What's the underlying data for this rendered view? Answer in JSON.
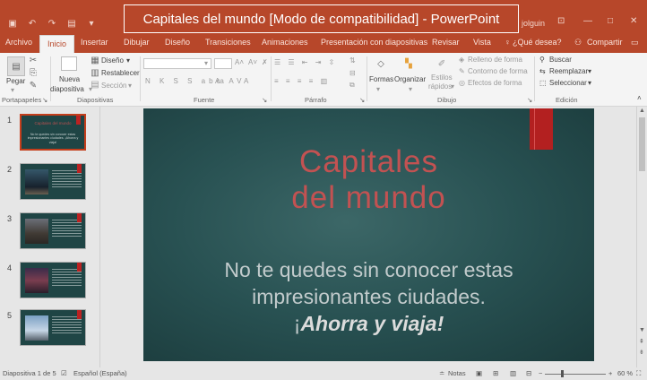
{
  "title_bar": {
    "window_title": "Capitales del mundo [Modo de compatibilidad]  -  PowerPoint",
    "user": "jolguin",
    "qat_icons": [
      "save-icon",
      "undo-icon",
      "redo-icon",
      "present-icon",
      "customize-icon"
    ]
  },
  "tabs": [
    "Archivo",
    "Inicio",
    "Insertar",
    "Dibujar",
    "Diseño",
    "Transiciones",
    "Animaciones",
    "Presentación con diapositivas",
    "Revisar",
    "Vista"
  ],
  "tell_me": "¿Qué desea?",
  "share": "Compartir",
  "ribbon": {
    "paste": "Pegar",
    "new_slide_1": "Nueva",
    "new_slide_2": "diapositiva",
    "layout": "Diseño",
    "reset": "Restablecer",
    "section": "Sección",
    "shapes": "Formas",
    "arrange": "Organizar",
    "quick_styles_1": "Estilos",
    "quick_styles_2": "rápidos",
    "shape_fill": "Relleno de forma",
    "shape_outline": "Contorno de forma",
    "shape_effects": "Efectos de forma",
    "find": "Buscar",
    "replace": "Reemplazar",
    "select": "Seleccionar",
    "groups": {
      "clipboard": "Portapapeles",
      "slides": "Diapositivas",
      "font": "Fuente",
      "paragraph": "Párrafo",
      "drawing": "Dibujo",
      "editing": "Edición"
    }
  },
  "thumbnails": [
    {
      "num": "1",
      "title": "Capitales del mundo",
      "sub": "No te quedes sin conocer estas impresionantes ciudades. ¡Ahorra y viaja!"
    },
    {
      "num": "2"
    },
    {
      "num": "3"
    },
    {
      "num": "4"
    },
    {
      "num": "5"
    }
  ],
  "slide": {
    "title_line1": "Capitales",
    "title_line2": "del mundo",
    "sub_line1": "No te quedes sin conocer estas",
    "sub_line2": "impresionantes ciudades.",
    "sub_line3_a": "¡",
    "sub_line3_b": "Ahorra y viaja!"
  },
  "status": {
    "slide_info": "Diapositiva 1 de 5",
    "language": "Español (España)",
    "notes": "Notas",
    "zoom": "60 %"
  },
  "colors": {
    "accent": "#b7472a",
    "slide_bg": "#285152",
    "slide_title": "#c25252"
  }
}
